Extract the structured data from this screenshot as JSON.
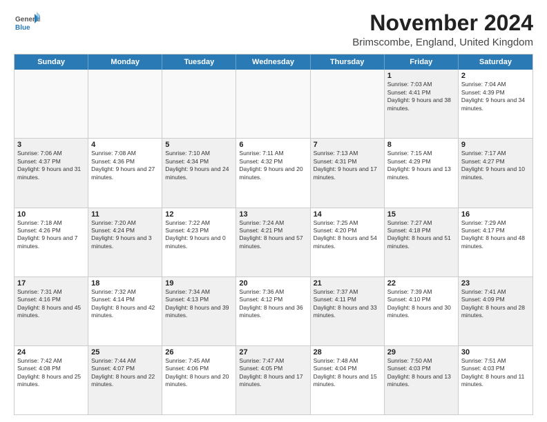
{
  "logo": {
    "general": "General",
    "blue": "Blue"
  },
  "title": "November 2024",
  "location": "Brimscombe, England, United Kingdom",
  "headers": [
    "Sunday",
    "Monday",
    "Tuesday",
    "Wednesday",
    "Thursday",
    "Friday",
    "Saturday"
  ],
  "rows": [
    [
      {
        "day": "",
        "info": "",
        "empty": true
      },
      {
        "day": "",
        "info": "",
        "empty": true
      },
      {
        "day": "",
        "info": "",
        "empty": true
      },
      {
        "day": "",
        "info": "",
        "empty": true
      },
      {
        "day": "",
        "info": "",
        "empty": true
      },
      {
        "day": "1",
        "info": "Sunrise: 7:03 AM\nSunset: 4:41 PM\nDaylight: 9 hours and 38 minutes.",
        "shaded": true
      },
      {
        "day": "2",
        "info": "Sunrise: 7:04 AM\nSunset: 4:39 PM\nDaylight: 9 hours and 34 minutes.",
        "shaded": false
      }
    ],
    [
      {
        "day": "3",
        "info": "Sunrise: 7:06 AM\nSunset: 4:37 PM\nDaylight: 9 hours and 31 minutes.",
        "shaded": true
      },
      {
        "day": "4",
        "info": "Sunrise: 7:08 AM\nSunset: 4:36 PM\nDaylight: 9 hours and 27 minutes.",
        "shaded": false
      },
      {
        "day": "5",
        "info": "Sunrise: 7:10 AM\nSunset: 4:34 PM\nDaylight: 9 hours and 24 minutes.",
        "shaded": true
      },
      {
        "day": "6",
        "info": "Sunrise: 7:11 AM\nSunset: 4:32 PM\nDaylight: 9 hours and 20 minutes.",
        "shaded": false
      },
      {
        "day": "7",
        "info": "Sunrise: 7:13 AM\nSunset: 4:31 PM\nDaylight: 9 hours and 17 minutes.",
        "shaded": true
      },
      {
        "day": "8",
        "info": "Sunrise: 7:15 AM\nSunset: 4:29 PM\nDaylight: 9 hours and 13 minutes.",
        "shaded": false
      },
      {
        "day": "9",
        "info": "Sunrise: 7:17 AM\nSunset: 4:27 PM\nDaylight: 9 hours and 10 minutes.",
        "shaded": true
      }
    ],
    [
      {
        "day": "10",
        "info": "Sunrise: 7:18 AM\nSunset: 4:26 PM\nDaylight: 9 hours and 7 minutes.",
        "shaded": false
      },
      {
        "day": "11",
        "info": "Sunrise: 7:20 AM\nSunset: 4:24 PM\nDaylight: 9 hours and 3 minutes.",
        "shaded": true
      },
      {
        "day": "12",
        "info": "Sunrise: 7:22 AM\nSunset: 4:23 PM\nDaylight: 9 hours and 0 minutes.",
        "shaded": false
      },
      {
        "day": "13",
        "info": "Sunrise: 7:24 AM\nSunset: 4:21 PM\nDaylight: 8 hours and 57 minutes.",
        "shaded": true
      },
      {
        "day": "14",
        "info": "Sunrise: 7:25 AM\nSunset: 4:20 PM\nDaylight: 8 hours and 54 minutes.",
        "shaded": false
      },
      {
        "day": "15",
        "info": "Sunrise: 7:27 AM\nSunset: 4:18 PM\nDaylight: 8 hours and 51 minutes.",
        "shaded": true
      },
      {
        "day": "16",
        "info": "Sunrise: 7:29 AM\nSunset: 4:17 PM\nDaylight: 8 hours and 48 minutes.",
        "shaded": false
      }
    ],
    [
      {
        "day": "17",
        "info": "Sunrise: 7:31 AM\nSunset: 4:16 PM\nDaylight: 8 hours and 45 minutes.",
        "shaded": true
      },
      {
        "day": "18",
        "info": "Sunrise: 7:32 AM\nSunset: 4:14 PM\nDaylight: 8 hours and 42 minutes.",
        "shaded": false
      },
      {
        "day": "19",
        "info": "Sunrise: 7:34 AM\nSunset: 4:13 PM\nDaylight: 8 hours and 39 minutes.",
        "shaded": true
      },
      {
        "day": "20",
        "info": "Sunrise: 7:36 AM\nSunset: 4:12 PM\nDaylight: 8 hours and 36 minutes.",
        "shaded": false
      },
      {
        "day": "21",
        "info": "Sunrise: 7:37 AM\nSunset: 4:11 PM\nDaylight: 8 hours and 33 minutes.",
        "shaded": true
      },
      {
        "day": "22",
        "info": "Sunrise: 7:39 AM\nSunset: 4:10 PM\nDaylight: 8 hours and 30 minutes.",
        "shaded": false
      },
      {
        "day": "23",
        "info": "Sunrise: 7:41 AM\nSunset: 4:09 PM\nDaylight: 8 hours and 28 minutes.",
        "shaded": true
      }
    ],
    [
      {
        "day": "24",
        "info": "Sunrise: 7:42 AM\nSunset: 4:08 PM\nDaylight: 8 hours and 25 minutes.",
        "shaded": false
      },
      {
        "day": "25",
        "info": "Sunrise: 7:44 AM\nSunset: 4:07 PM\nDaylight: 8 hours and 22 minutes.",
        "shaded": true
      },
      {
        "day": "26",
        "info": "Sunrise: 7:45 AM\nSunset: 4:06 PM\nDaylight: 8 hours and 20 minutes.",
        "shaded": false
      },
      {
        "day": "27",
        "info": "Sunrise: 7:47 AM\nSunset: 4:05 PM\nDaylight: 8 hours and 17 minutes.",
        "shaded": true
      },
      {
        "day": "28",
        "info": "Sunrise: 7:48 AM\nSunset: 4:04 PM\nDaylight: 8 hours and 15 minutes.",
        "shaded": false
      },
      {
        "day": "29",
        "info": "Sunrise: 7:50 AM\nSunset: 4:03 PM\nDaylight: 8 hours and 13 minutes.",
        "shaded": true
      },
      {
        "day": "30",
        "info": "Sunrise: 7:51 AM\nSunset: 4:03 PM\nDaylight: 8 hours and 11 minutes.",
        "shaded": false
      }
    ]
  ]
}
